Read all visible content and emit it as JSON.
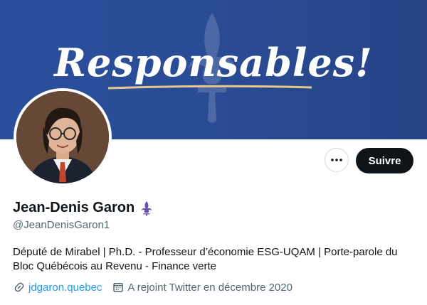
{
  "banner": {
    "slogan": "Responsables!",
    "bg_color": "#2b4f9c",
    "underline_color": "#e6c88a"
  },
  "profile": {
    "display_name": "Jean-Denis Garon",
    "badge_icon": "fleur-de-lys-icon",
    "badge_color": "#6b4fb3",
    "handle": "@JeanDenisGaron1",
    "bio": "Député de Mirabel | Ph.D. - Professeur d’économie ESG-UQAM | Porte-parole du Bloc Québécois au Revenu - Finance verte",
    "website": "jdgaron.quebec",
    "joined": "A rejoint Twitter en décembre 2020"
  },
  "actions": {
    "more_icon": "more-horizontal-icon",
    "follow_label": "Suivre"
  },
  "colors": {
    "accent": "#1d9bf0",
    "secondary_text": "#536471",
    "primary_text": "#0f1419"
  }
}
